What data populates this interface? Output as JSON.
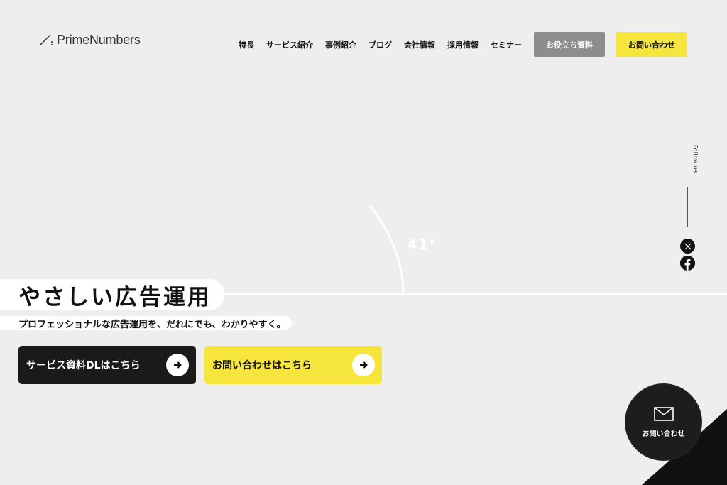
{
  "header": {
    "logo_text": "PrimeNumbers",
    "nav": [
      {
        "label": "特長"
      },
      {
        "label": "サービス紹介"
      },
      {
        "label": "事例紹介"
      },
      {
        "label": "ブログ"
      },
      {
        "label": "会社情報"
      },
      {
        "label": "採用情報"
      },
      {
        "label": "セミナー"
      }
    ],
    "materials_button": "お役立ち資料",
    "contact_button": "お問い合わせ"
  },
  "hero": {
    "angle_label": "41°",
    "headline": "やさしい広告運用",
    "subline": "プロフェッショナルな広告運用を、だれにでも、わかりやすく。",
    "cta_download": "サービス資料DLはこちら",
    "cta_contact": "お問い合わせはこちら"
  },
  "social": {
    "follow_label": "Follow us",
    "x_icon": "x-icon",
    "facebook_icon": "facebook-icon"
  },
  "floating_contact": {
    "label": "お問い合わせ",
    "icon": "envelope-icon"
  },
  "colors": {
    "background": "#eeeeee",
    "accent_yellow": "#f5e53c",
    "dark": "#1a1a1a",
    "gray_button": "#8d8d8d"
  }
}
